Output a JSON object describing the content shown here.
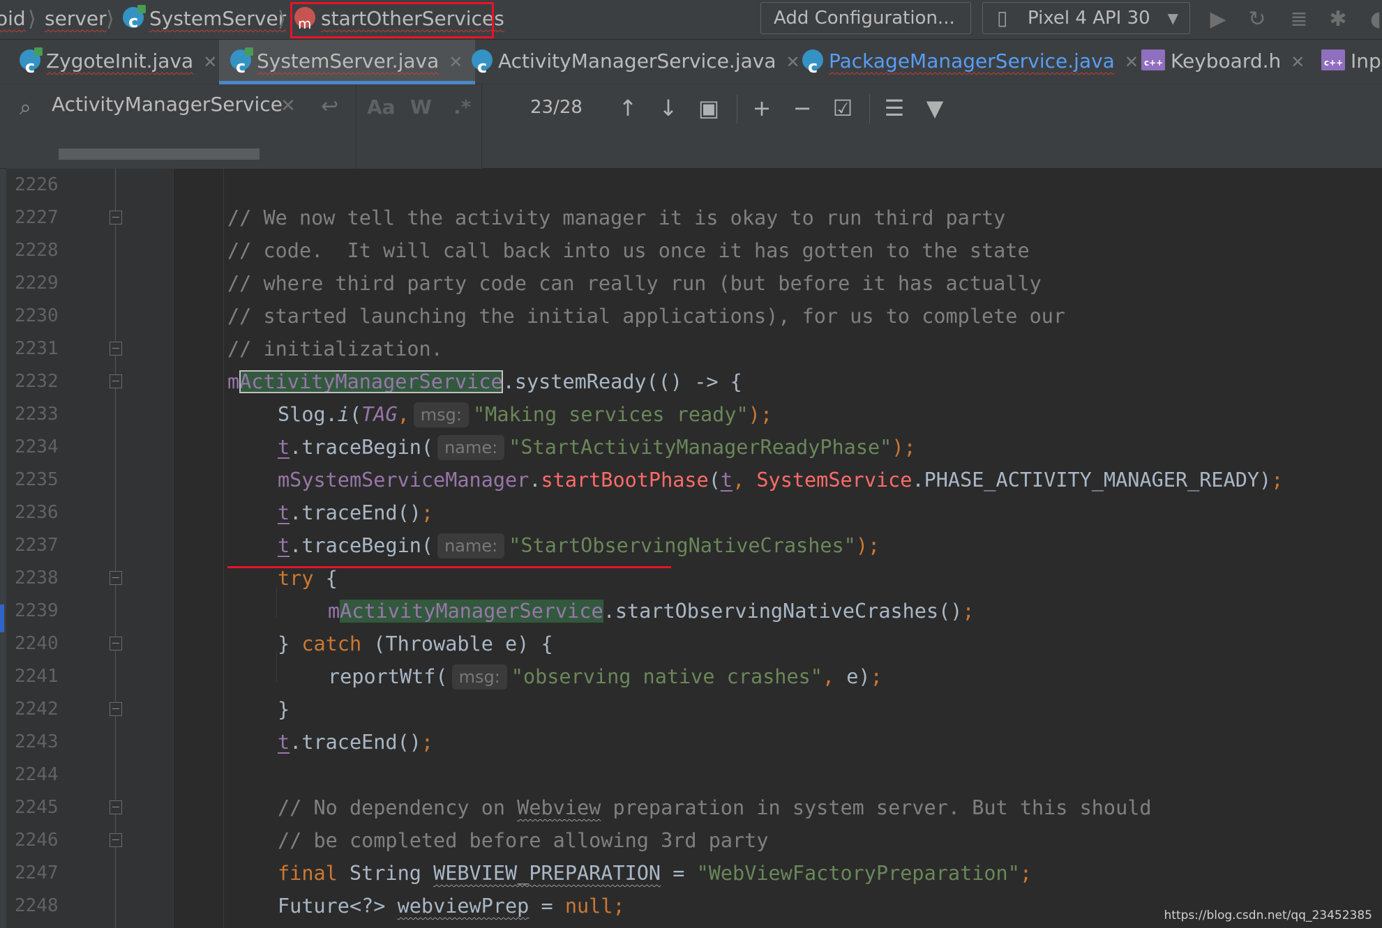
{
  "breadcrumb": {
    "items": [
      "oid",
      "server",
      "SystemServer",
      "startOtherServices"
    ],
    "separator": "⟩",
    "highlight_color": "#e8132a"
  },
  "toolbar": {
    "add_configuration_label": "Add Configuration...",
    "device_label": "Pixel 4 API 30",
    "icons": [
      "run-icon",
      "rerun-icon",
      "build-icon",
      "debug-icon",
      "stop-icon"
    ]
  },
  "tabs": [
    {
      "label": "ZygoteInit.java",
      "icon": "java-class-icon",
      "active": false
    },
    {
      "label": "SystemServer.java",
      "icon": "java-class-icon",
      "active": true
    },
    {
      "label": "ActivityManagerService.java",
      "icon": "java-class-icon",
      "active": false
    },
    {
      "label": "PackageManagerService.java",
      "icon": "java-class-icon",
      "active": false
    },
    {
      "label": "Keyboard.h",
      "icon": "cpp-header-icon",
      "active": false
    },
    {
      "label": "Inp",
      "icon": "cpp-header-icon",
      "active": false
    }
  ],
  "find": {
    "query": "ActivityManagerService",
    "match_case_label": "Aa",
    "whole_words_label": "W",
    "regex_label": ".*",
    "match_count": "23/28"
  },
  "editor": {
    "line_numbers": [
      "2226",
      "2227",
      "2228",
      "2229",
      "2230",
      "2231",
      "2232",
      "2233",
      "2234",
      "2235",
      "2236",
      "2237",
      "2238",
      "2239",
      "2240",
      "2241",
      "2242",
      "2243",
      "2244",
      "2245",
      "2246",
      "2247",
      "2248"
    ],
    "lines": {
      "l2227": "// We now tell the activity manager it is okay to run third party",
      "l2228": "// code.  It will call back into us once it has gotten to the state",
      "l2229": "// where third party code can really run (but before it has actually",
      "l2230": "// started launching the initial applications), for us to complete our",
      "l2231": "// initialization.",
      "l2232": {
        "a": "m",
        "b": "ActivityManagerService",
        "c": ".systemReady(() -> {"
      },
      "l2233": {
        "a": "Slog.",
        "b": "i",
        "c": "(",
        "d": "TAG",
        "e": ",",
        "hint": "msg:",
        "f": "\"Making services ready\"",
        "g": ");"
      },
      "l2234": {
        "a": "t",
        "b": ".traceBegin(",
        "hint": "name:",
        "c": "\"StartActivityManagerReadyPhase\"",
        "d": ");"
      },
      "l2235": {
        "a": "mSystemServiceManager",
        "b": ".",
        "c": "startBootPhase",
        "d": "(",
        "e": "t",
        "f": ", ",
        "g": "SystemService",
        "h": ".PHASE_ACTIVITY_MANAGER_READY)",
        "i": ";"
      },
      "l2236": {
        "a": "t",
        "b": ".traceEnd()",
        "c": ";"
      },
      "l2237": {
        "a": "t",
        "b": ".traceBegin(",
        "hint": "name:",
        "c": "\"StartObservingNativeCrashes\"",
        "d": ");"
      },
      "l2238": {
        "a": "try",
        "b": " {"
      },
      "l2239": {
        "a": "m",
        "b": "ActivityManagerService",
        "c": ".startObservingNativeCrashes()",
        "d": ";"
      },
      "l2240": {
        "a": "} ",
        "b": "catch",
        "c": " (Throwable e) {"
      },
      "l2241": {
        "a": "reportWtf(",
        "hint": "msg:",
        "b": "\"observing native crashes\"",
        "c": ", ",
        "d": "e)",
        "e": ";"
      },
      "l2242": "}",
      "l2243": {
        "a": "t",
        "b": ".traceEnd()",
        "c": ";"
      },
      "l2245": {
        "a": "// No dependency on ",
        "b": "Webview",
        "c": " preparation in system server. But this should"
      },
      "l2246": "// be completed before allowing 3rd party",
      "l2247": {
        "a": "final",
        "b": " String ",
        "c": "WEBVIEW_PREPARATION",
        "d": " = ",
        "e": "\"WebViewFactoryPreparation\"",
        "f": ";"
      },
      "l2248": {
        "a": "Future<?> ",
        "b": "webviewPrep",
        "c": " = ",
        "d": "null",
        "e": ";"
      }
    }
  },
  "watermark": "https://blog.csdn.net/qq_23452385",
  "colors": {
    "background": "#2b2b2b",
    "keyword": "#cc7832",
    "string": "#6a8759",
    "field": "#9876aa",
    "comment": "#808080",
    "search_match": "#32593d",
    "annotation_red": "#e8132a"
  }
}
